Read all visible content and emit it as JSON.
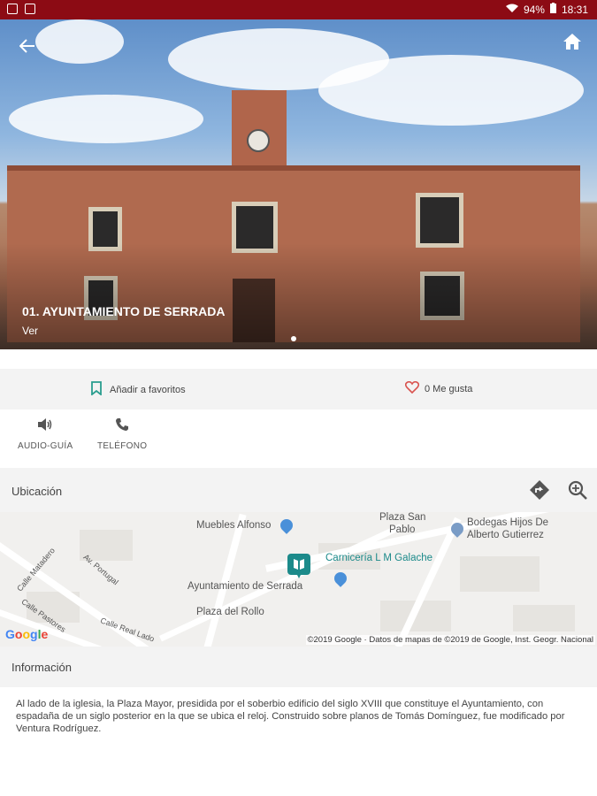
{
  "status_bar": {
    "battery": "94%",
    "time": "18:31"
  },
  "hero": {
    "title": "01. AYUNTAMIENTO DE SERRADA",
    "subtitle": "Ver"
  },
  "actions": {
    "favorite_label": "Añadir a favoritos",
    "like_label": "0 Me gusta"
  },
  "contacts": {
    "audio_label": "AUDIO-GUÍA",
    "phone_label": "TELÉFONO"
  },
  "location": {
    "label": "Ubicación"
  },
  "map": {
    "labels": {
      "muebles": "Muebles Alfonso",
      "plaza_san_pablo_1": "Plaza San",
      "plaza_san_pablo_2": "Pablo",
      "bodegas_1": "Bodegas Hijos De",
      "bodegas_2": "Alberto Gutierrez",
      "carniceria": "Carnicería L M Galache",
      "ayuntamiento": "Ayuntamiento de Serrada",
      "plaza_rollo": "Plaza del Rollo",
      "calle_matadero": "Calle Matadero",
      "av_portugal": "Av. Portugal",
      "calle_pastores": "Calle Pastores",
      "calle_real": "Calle Real Lado"
    },
    "google": "Google",
    "copyright": "©2019 Google · Datos de mapas de ©2019 de Google, Inst. Geogr. Nacional"
  },
  "info": {
    "label": "Información",
    "text": "Al lado de la iglesia, la Plaza Mayor, presidida por el soberbio edificio del siglo XVIII que constituye el Ayuntamiento, con espadaña de un siglo posterior en la que se ubica el reloj. Construido sobre planos de Tomás Domínguez, fue modificado por Ventura Rodríguez."
  },
  "colors": {
    "status_bar": "#8c0b14",
    "accent_teal": "#2a9d8f",
    "heart": "#d9534f",
    "pin_blue": "#4a90d9",
    "marker_teal": "#1c8a8a"
  }
}
